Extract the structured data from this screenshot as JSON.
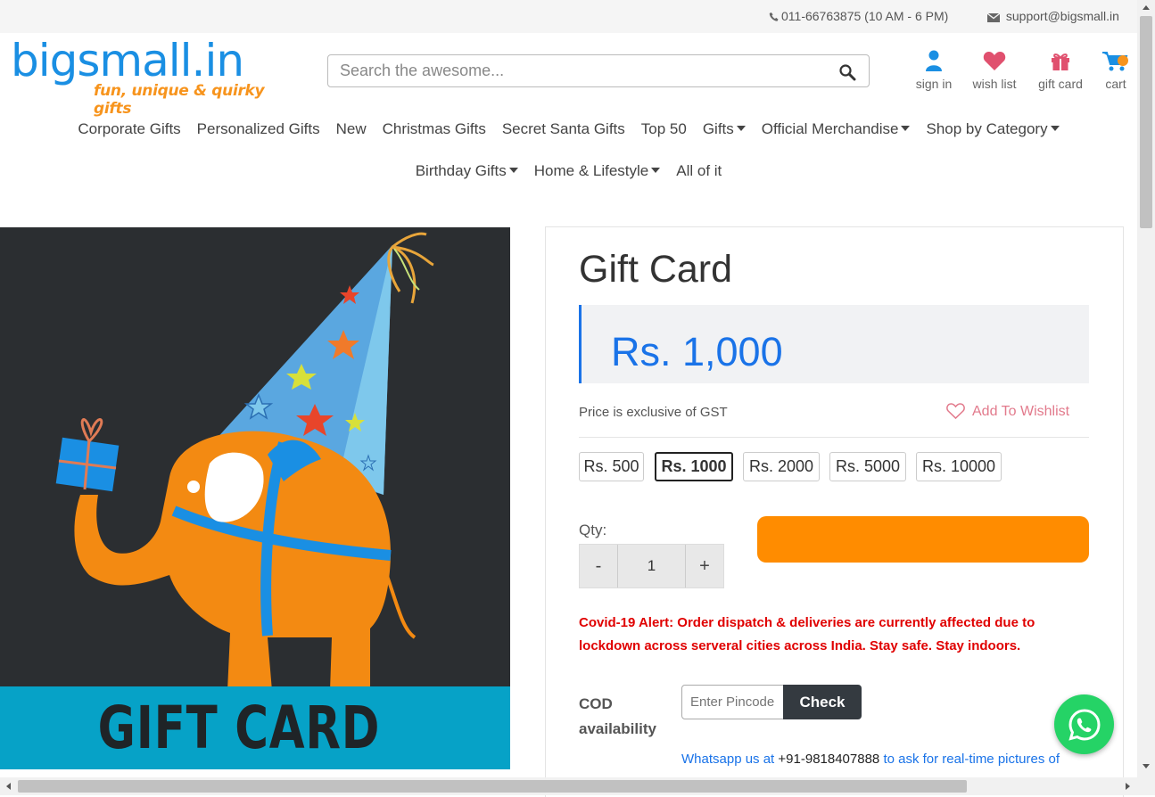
{
  "topbar": {
    "phone": "011-66763875 (10 AM - 6 PM)",
    "email": "support@bigsmall.in"
  },
  "logo": {
    "brand": "bigsmall.in",
    "tagline": "fun, unique & quirky gifts"
  },
  "search": {
    "placeholder": "Search the awesome..."
  },
  "header_actions": {
    "signin": "sign in",
    "wishlist": "wish list",
    "giftcard": "gift card",
    "cart": "cart"
  },
  "nav": {
    "row1": [
      {
        "label": "Corporate Gifts",
        "dropdown": false
      },
      {
        "label": "Personalized Gifts",
        "dropdown": false
      },
      {
        "label": "New",
        "dropdown": false
      },
      {
        "label": "Christmas Gifts",
        "dropdown": false
      },
      {
        "label": "Secret Santa Gifts",
        "dropdown": false
      },
      {
        "label": "Top 50",
        "dropdown": false
      },
      {
        "label": "Gifts",
        "dropdown": true
      },
      {
        "label": "Official Merchandise",
        "dropdown": true
      },
      {
        "label": "Shop by Category",
        "dropdown": true
      }
    ],
    "row2": [
      {
        "label": "Birthday Gifts",
        "dropdown": true
      },
      {
        "label": "Home & Lifestyle",
        "dropdown": true
      },
      {
        "label": "All of it",
        "dropdown": false
      }
    ]
  },
  "product": {
    "image_text": "GIFT CARD",
    "title": "Gift Card",
    "price": "Rs. 1,000",
    "gst_note": "Price is exclusive of GST",
    "wishlist_label": "Add To Wishlist",
    "denominations": [
      "Rs. 500",
      "Rs. 1000",
      "Rs. 2000",
      "Rs. 5000",
      "Rs. 10000"
    ],
    "selected_denomination": "Rs. 1000",
    "qty_label": "Qty:",
    "qty_value": "1",
    "qty_minus": "-",
    "qty_plus": "+",
    "covid_alert": "Covid-19 Alert: Order dispatch & deliveries are currently affected due to lockdown across serveral cities across India. Stay safe. Stay indoors.",
    "cod_label_1": "COD",
    "cod_label_2": "availability",
    "pincode_placeholder": "Enter Pincode",
    "check_label": "Check",
    "whatsapp_prefix": "Whatsapp us at ",
    "whatsapp_number": "+91-9818407888",
    "whatsapp_suffix": " to ask for real-time pictures of"
  },
  "colors": {
    "brand_blue": "#1a8fe3",
    "brand_orange": "#f7941d",
    "price_blue": "#1a73e8",
    "cart_button": "#ff8c00",
    "alert_red": "#e00000",
    "whatsapp_green": "#25d366"
  }
}
